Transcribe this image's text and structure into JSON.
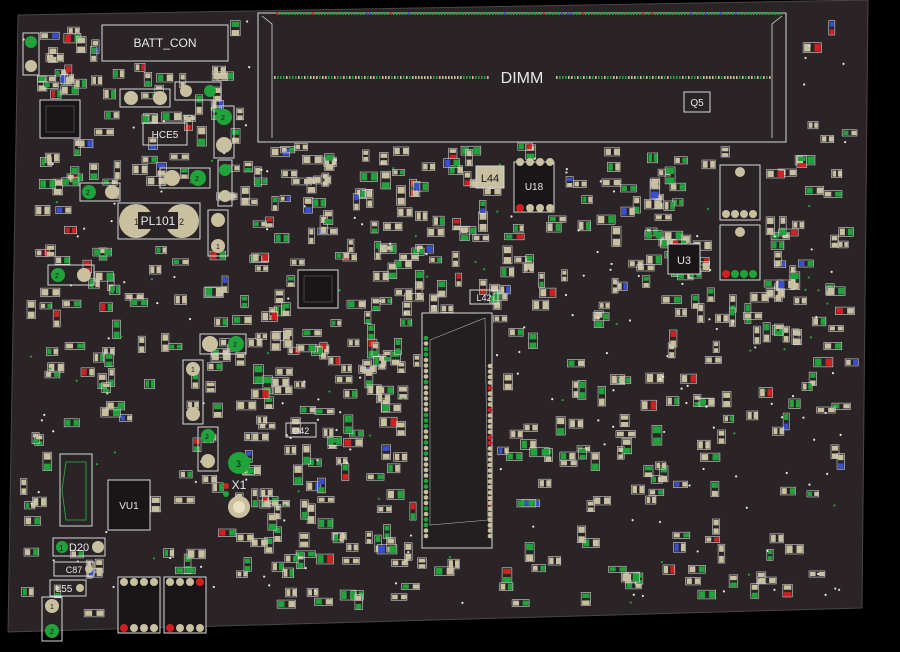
{
  "colors": {
    "background": "#000000",
    "board": "#2a2426",
    "silkscreen": "#d8d8d8",
    "pad": "#c9c0a0",
    "pad_green": "#1fa33a",
    "pad_red": "#d22020",
    "pad_blue": "#3a4fd0"
  },
  "labels": {
    "batt_con": "BATT_CON",
    "dimm": "DIMM",
    "hce5": "HCE5",
    "pl101": "PL101",
    "pl101_pin1": "1",
    "pl101_pin2": "2",
    "l44": "L44",
    "u18": "U18",
    "q5": "Q5",
    "u3": "U3",
    "l42": "L42",
    "d42": "D42",
    "x1": "X1",
    "x1_pin": "3",
    "vu1": "VU1",
    "d20": "D20",
    "d20_pin": "1",
    "c87": "C87",
    "l55": "L55",
    "pin_2": "2",
    "pin_1": "1"
  }
}
